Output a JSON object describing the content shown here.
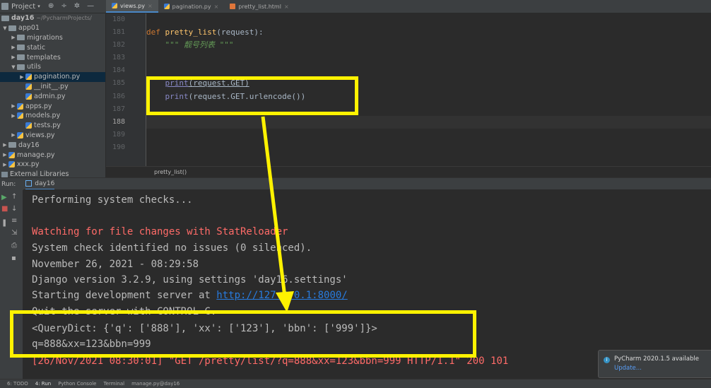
{
  "project_header": {
    "label": "Project"
  },
  "editor_tabs": [
    {
      "label": "views.py",
      "icon": "python-file-icon"
    },
    {
      "label": "pagination.py",
      "icon": "python-file-icon"
    },
    {
      "label": "pretty_list.html",
      "icon": "html-file-icon"
    }
  ],
  "tree": {
    "root": "day16",
    "root_path": "~/PycharmProjects/",
    "items": [
      "app01",
      "migrations",
      "static",
      "templates",
      "utils",
      "pagination.py",
      "__init__.py",
      "admin.py",
      "apps.py",
      "models.py",
      "tests.py",
      "views.py",
      "day16",
      "manage.py",
      "xxx.py",
      "External Libraries"
    ]
  },
  "editor": {
    "line_numbers": [
      "180",
      "181",
      "182",
      "183",
      "184",
      "185",
      "186",
      "187",
      "188",
      "189",
      "190"
    ],
    "code": {
      "def_kw": "def",
      "func_name": "pretty_list",
      "params": "(request):",
      "docstring": "\"\"\" 靓号列表 \"\"\"",
      "print1_fn": "print",
      "print1_arg": "(request.GET)",
      "print2_fn": "print",
      "print2_arg": "(request.GET.urlencode())"
    },
    "breadcrumb": "pretty_list()"
  },
  "run_panel": {
    "label": "Run:",
    "tab": "day16",
    "console_lines": {
      "l1": "Performing system checks...",
      "l2": "Watching for file changes with StatReloader",
      "l3": "System check identified no issues (0 silenced).",
      "l4": "November 26, 2021 - 08:29:58",
      "l5": "Django version 3.2.9, using settings 'day16.settings'",
      "l6_prefix": "Starting development server at ",
      "l6_link": "http://127.0.0.1:8000/",
      "l7": "Quit the server with CONTROL-C.",
      "l8": "<QueryDict: {'q': ['888'], 'xx': ['123'], 'bbn': ['999']}>",
      "l9": "q=888&xx=123&bbn=999",
      "l10": "[26/Nov/2021 08:30:01] \"GET /pretty/list/?q=888&xx=123&bbn=999 HTTP/1.1\" 200 101"
    }
  },
  "notification": {
    "title": "PyCharm 2020.1.5 available",
    "action": "Update..."
  },
  "statusbar": [
    "6: TODO",
    "4: Run",
    "Python Console",
    "Terminal",
    "manage.py@day16"
  ],
  "colors": {
    "highlight": "#fff200",
    "accent": "#4a88c7",
    "error_text": "#ff6b68"
  }
}
